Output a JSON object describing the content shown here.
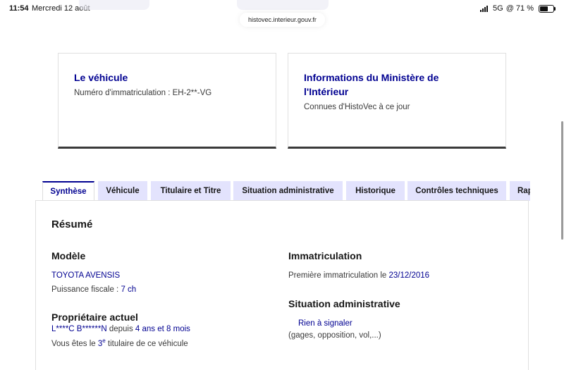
{
  "status_bar": {
    "time": "11:54",
    "date": "Mercredi 12 août",
    "network": "5G",
    "battery_text": "@ 71 %",
    "battery_level": 0.71
  },
  "browser": {
    "url": "histovec.interieur.gouv.fr"
  },
  "cards": [
    {
      "title": "Le véhicule",
      "subtitle": "Numéro d'immatriculation : EH-2**-VG"
    },
    {
      "title_line1": "Informations du Ministère de",
      "title_line2": "l'Intérieur",
      "subtitle": "Connues d'HistoVec à ce jour"
    }
  ],
  "tabs": [
    {
      "label": "Synthèse"
    },
    {
      "label": "Véhicule"
    },
    {
      "label": "Titulaire et Titre"
    },
    {
      "label": "Situation administrative"
    },
    {
      "label": "Historique"
    },
    {
      "label": "Contrôles techniques"
    },
    {
      "label": "Rap"
    }
  ],
  "summary": {
    "title": "Résumé",
    "model": {
      "heading": "Modèle",
      "name": "TOYOTA AVENSIS",
      "power_label": "Puissance fiscale : ",
      "power_value": "7 ch"
    },
    "owner": {
      "heading": "Propriétaire actuel",
      "name": "L****C B******N",
      "since_label": " depuis ",
      "since_value": "4 ans et 8 mois",
      "rank_prefix": "Vous êtes le ",
      "rank_number": "3",
      "rank_sup": "e",
      "rank_suffix": " titulaire de ce véhicule"
    },
    "registration": {
      "heading": "Immatriculation",
      "first_label": "Première immatriculation le ",
      "first_date": "23/12/2016"
    },
    "admin": {
      "heading": "Situation administrative",
      "status": "Rien à signaler",
      "details": "(gages, opposition, vol,...)"
    }
  }
}
